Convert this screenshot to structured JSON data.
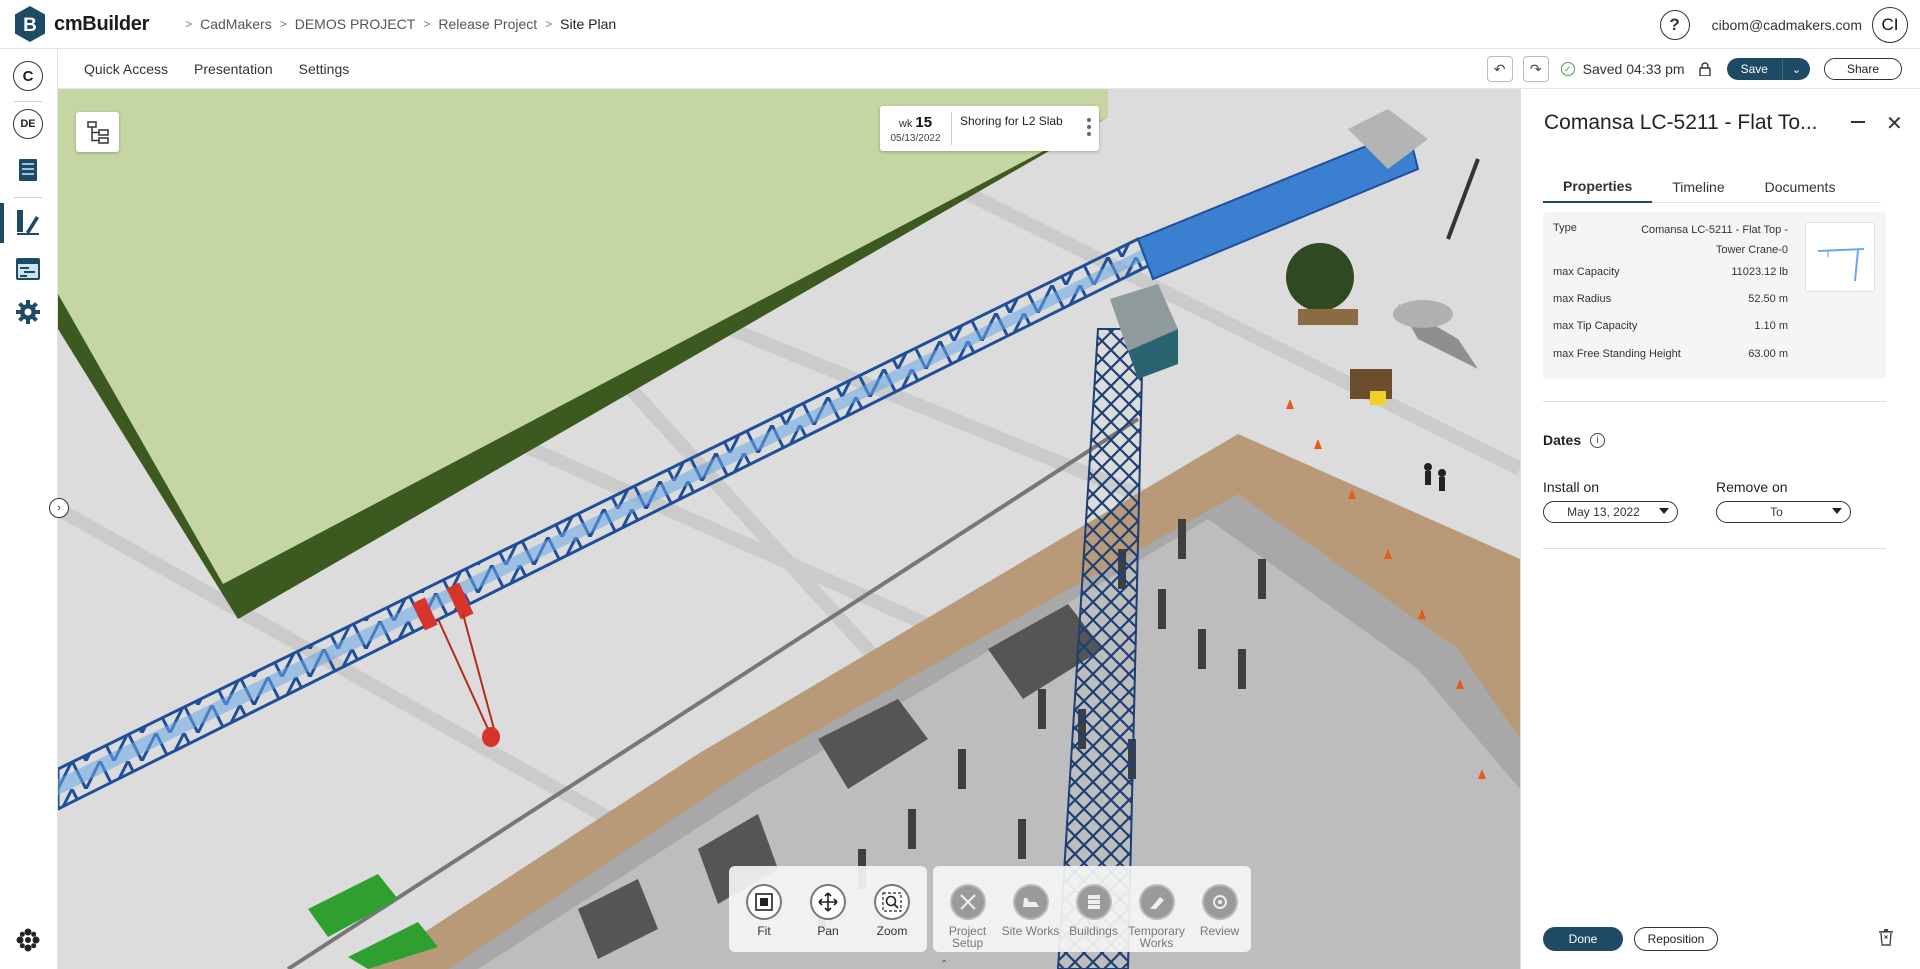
{
  "app": {
    "name": "cmBuilder"
  },
  "breadcrumb": [
    "CadMakers",
    "DEMOS PROJECT",
    "Release Project",
    "Site Plan"
  ],
  "header": {
    "help_label": "?",
    "user_email": "cibom@cadmakers.com",
    "user_initials": "CI"
  },
  "rail": {
    "company_initial": "C",
    "user_initials": "DE"
  },
  "menu": {
    "quick_access": "Quick Access",
    "presentation": "Presentation",
    "settings": "Settings"
  },
  "status": {
    "saved_text": "Saved 04:33 pm"
  },
  "actions": {
    "save": "Save",
    "share": "Share"
  },
  "week": {
    "prefix": "wk",
    "number": "15",
    "date": "05/13/2022",
    "task": "Shoring for L2 Slab"
  },
  "toolbar": {
    "view_tools": [
      {
        "label": "Fit",
        "icon": "fit-icon"
      },
      {
        "label": "Pan",
        "icon": "pan-icon"
      },
      {
        "label": "Zoom",
        "icon": "zoom-icon"
      }
    ],
    "mode_tools": [
      {
        "label": "Project Setup",
        "icon": "project-setup-icon"
      },
      {
        "label": "Site Works",
        "icon": "site-works-icon"
      },
      {
        "label": "Buildings",
        "icon": "buildings-icon"
      },
      {
        "label": "Temporary Works",
        "icon": "temporary-works-icon"
      },
      {
        "label": "Review",
        "icon": "review-icon"
      }
    ]
  },
  "panel": {
    "title": "Comansa LC-5211 - Flat To...",
    "tabs": [
      "Properties",
      "Timeline",
      "Documents"
    ],
    "active_tab": "Properties",
    "properties": [
      {
        "key": "Type",
        "value": "Comansa LC-5211 - Flat Top - Tower Crane-0"
      },
      {
        "key": "max Capacity",
        "value": "11023.12 lb"
      },
      {
        "key": "max Radius",
        "value": "52.50 m"
      },
      {
        "key": "max Tip Capacity",
        "value": "1.10 m"
      },
      {
        "key": "max Free Standing Height",
        "value": "63.00 m"
      }
    ],
    "dates_title": "Dates",
    "install_label": "Install on",
    "install_value": "May 13, 2022",
    "remove_label": "Remove on",
    "remove_value": "To",
    "done": "Done",
    "reposition": "Reposition"
  },
  "colors": {
    "brand": "#1e4a66",
    "crane_blue": "#3a7fd0",
    "grass_dark": "#3c5a1f",
    "grass_light": "#c5d6a4",
    "success": "#3aa55a"
  }
}
